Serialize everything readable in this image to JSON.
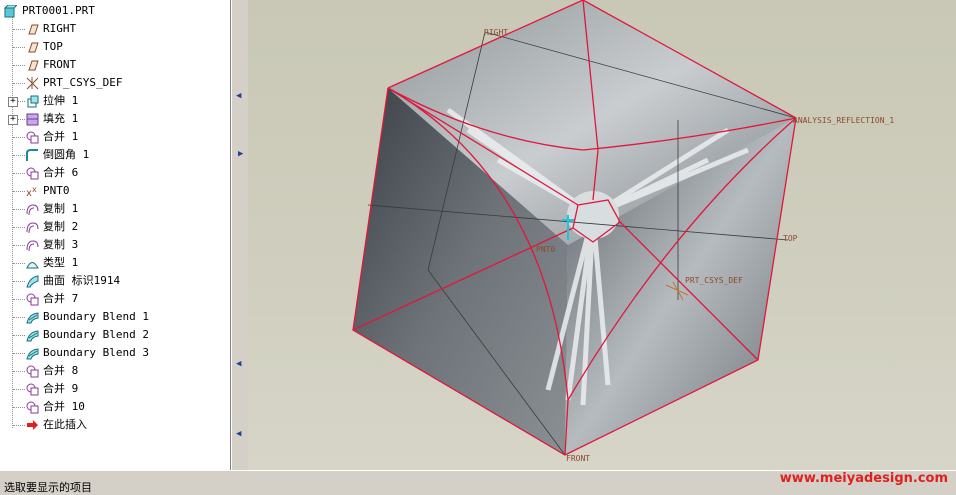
{
  "model_tree": {
    "items": [
      {
        "label": "PRT0001.PRT",
        "icon": "part-icon",
        "expandable": false
      },
      {
        "label": "RIGHT",
        "icon": "datum-plane-icon",
        "expandable": false
      },
      {
        "label": "TOP",
        "icon": "datum-plane-icon",
        "expandable": false
      },
      {
        "label": "FRONT",
        "icon": "datum-plane-icon",
        "expandable": false
      },
      {
        "label": "PRT_CSYS_DEF",
        "icon": "coordinate-system-icon",
        "expandable": false
      },
      {
        "label": "拉伸 1",
        "icon": "extrude-icon",
        "expandable": true
      },
      {
        "label": "填充 1",
        "icon": "fill-icon",
        "expandable": true
      },
      {
        "label": "合并 1",
        "icon": "merge-icon",
        "expandable": false
      },
      {
        "label": "倒圆角 1",
        "icon": "round-icon",
        "expandable": false
      },
      {
        "label": "合并 6",
        "icon": "merge-icon",
        "expandable": false
      },
      {
        "label": "PNT0",
        "icon": "datum-point-icon",
        "expandable": false
      },
      {
        "label": "复制 1",
        "icon": "copy-icon",
        "expandable": false
      },
      {
        "label": "复制 2",
        "icon": "copy-icon",
        "expandable": false
      },
      {
        "label": "复制 3",
        "icon": "copy-icon",
        "expandable": false
      },
      {
        "label": "类型 1",
        "icon": "type-icon",
        "expandable": false
      },
      {
        "label": "曲面 标识1914",
        "icon": "surface-icon",
        "expandable": false
      },
      {
        "label": "合并 7",
        "icon": "merge-icon",
        "expandable": false
      },
      {
        "label": "Boundary Blend 1",
        "icon": "boundary-blend-icon",
        "expandable": false
      },
      {
        "label": "Boundary Blend 2",
        "icon": "boundary-blend-icon",
        "expandable": false
      },
      {
        "label": "Boundary Blend 3",
        "icon": "boundary-blend-icon",
        "expandable": false
      },
      {
        "label": "合并 8",
        "icon": "merge-icon",
        "expandable": false
      },
      {
        "label": "合并 9",
        "icon": "merge-icon",
        "expandable": false
      },
      {
        "label": "合并 10",
        "icon": "merge-icon",
        "expandable": false
      },
      {
        "label": "在此插入",
        "icon": "insert-here-arrow-icon",
        "expandable": false
      }
    ]
  },
  "viewport": {
    "labels": {
      "right": "RIGHT",
      "top": "TOP",
      "front": "FRONT",
      "pnt": "PNT0",
      "csys": "PRT_CSYS_DEF",
      "analysis": "ANALYSIS_REFLECTION_1"
    },
    "colors": {
      "edge": "#e0173c",
      "surface": "#6e7478",
      "highlight": "#e6e9ec"
    }
  },
  "status_bar": {
    "text": "选取要显示的项目"
  },
  "watermark": "www.meiyadesign.com"
}
